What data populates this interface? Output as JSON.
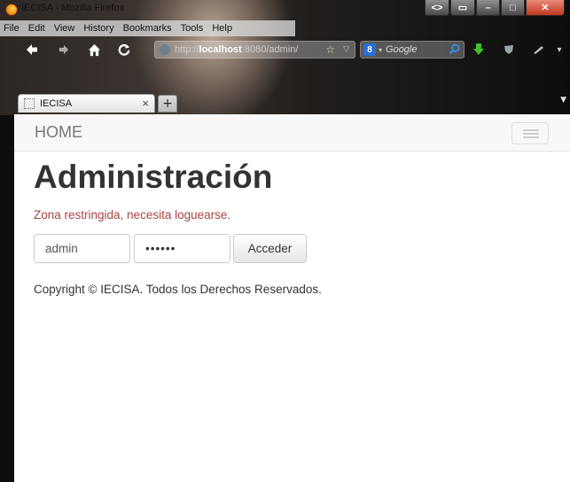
{
  "window": {
    "title": "IECISA - Mozilla Firefox"
  },
  "menubar": {
    "items": [
      "File",
      "Edit",
      "View",
      "History",
      "Bookmarks",
      "Tools",
      "Help"
    ]
  },
  "navbar": {
    "url_prefix": "http://",
    "url_host": "localhost",
    "url_rest": ":8080/admin/",
    "search_placeholder": "Google",
    "search_engine_glyph": "8"
  },
  "tabs": [
    {
      "label": "IECISA",
      "close": "×"
    }
  ],
  "newtab_label": "+",
  "page": {
    "brand": "HOME",
    "title": "Administración",
    "alert": "Zona restringida, necesita loguearse.",
    "login": {
      "username": "admin",
      "password": "••••••",
      "submit": "Acceder"
    },
    "footer": "Copyright © IECISA. Todos los Derechos Reservados."
  },
  "colors": {
    "alert": "#a94442",
    "brand": "#777777",
    "heading": "#333333"
  },
  "icons": [
    "firefox-logo-icon",
    "back-icon",
    "forward-icon",
    "home-icon",
    "reload-icon",
    "star-icon",
    "search-icon",
    "download-icon",
    "addon-icon",
    "menu-icon"
  ]
}
